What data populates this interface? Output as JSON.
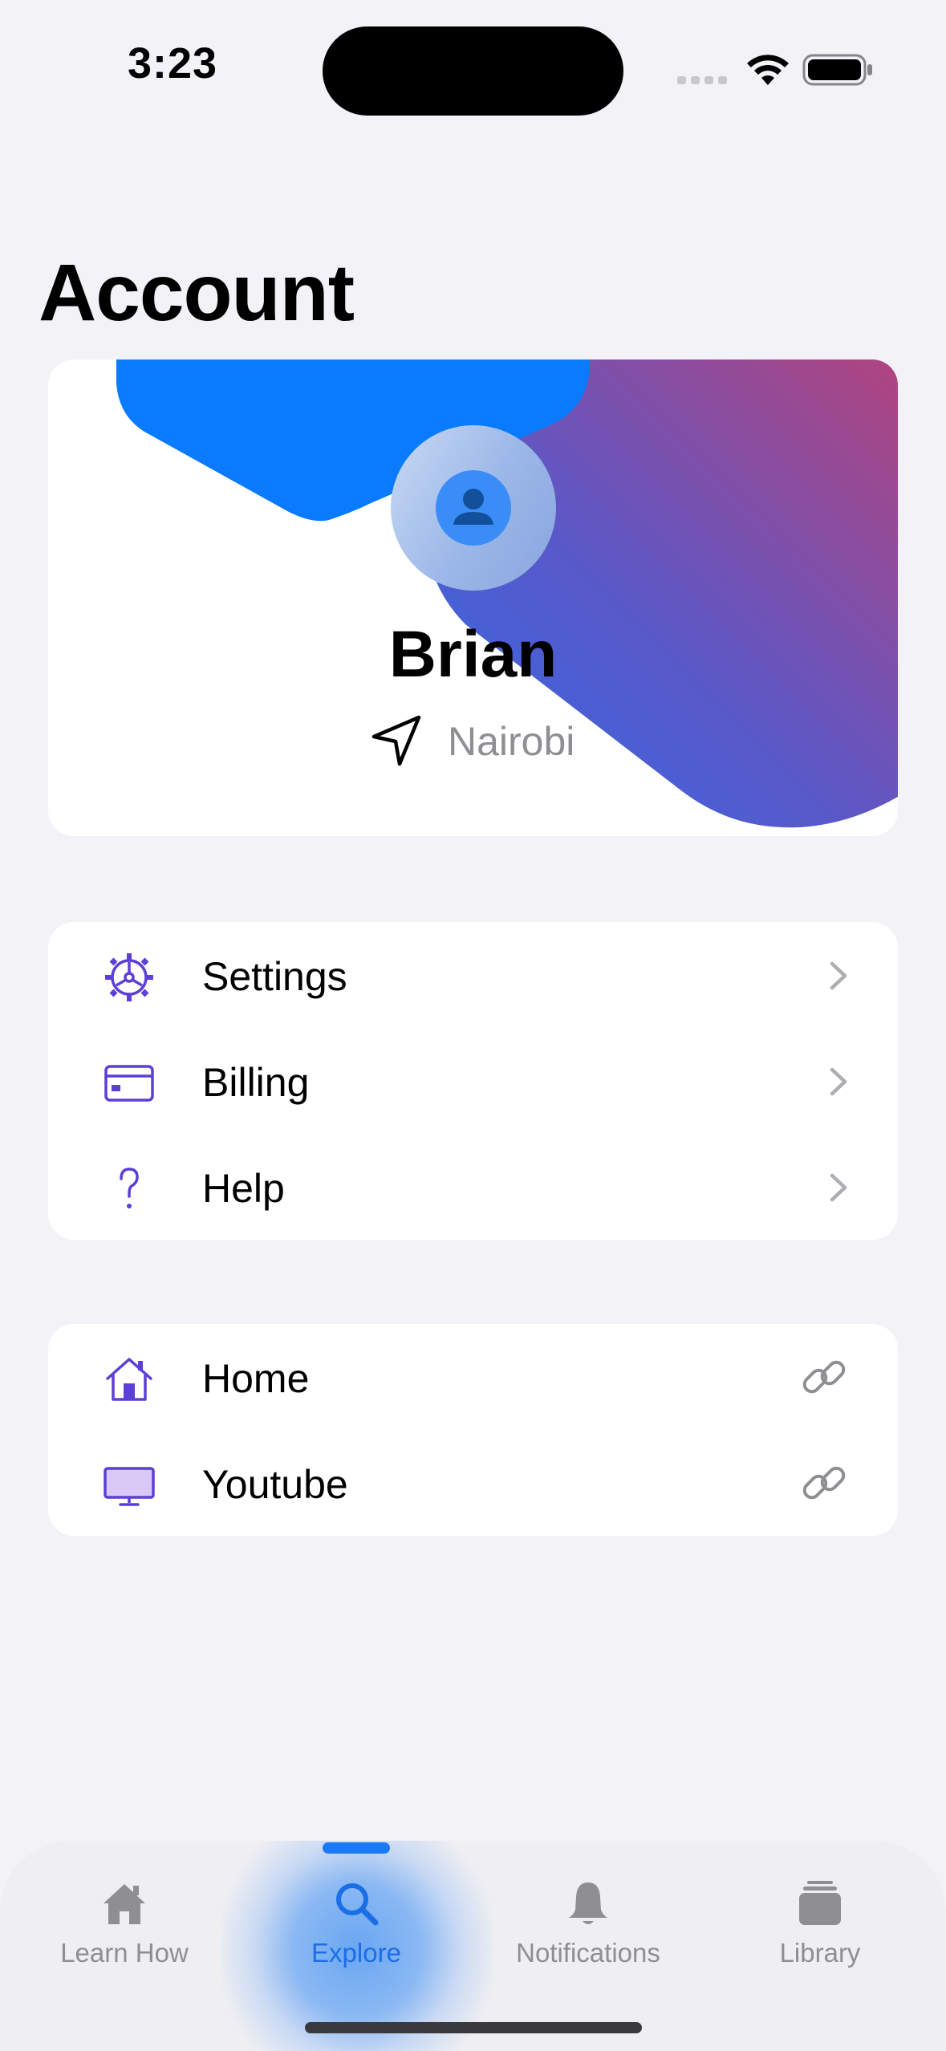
{
  "status_bar": {
    "time": "3:23",
    "signal_icon": "signal-dots-icon",
    "wifi_icon": "wifi-icon",
    "battery_icon": "battery-icon"
  },
  "page": {
    "title": "Account"
  },
  "profile": {
    "name": "Brian",
    "location": "Nairobi",
    "location_icon": "location-arrow-icon",
    "avatar_icon": "person-icon",
    "colors": {
      "blue": "#0a7bff",
      "gradient_start": "#3a6ee0",
      "gradient_end": "#b0447f"
    }
  },
  "menu": {
    "items": [
      {
        "label": "Settings",
        "icon": "gear-icon",
        "trailing": "chevron-right-icon"
      },
      {
        "label": "Billing",
        "icon": "credit-card-icon",
        "trailing": "chevron-right-icon"
      },
      {
        "label": "Help",
        "icon": "question-mark-icon",
        "trailing": "chevron-right-icon"
      }
    ]
  },
  "links": {
    "items": [
      {
        "label": "Home",
        "icon": "house-icon",
        "trailing": "link-icon"
      },
      {
        "label": "Youtube",
        "icon": "display-icon",
        "trailing": "link-icon"
      }
    ]
  },
  "tab_bar": {
    "active": "Explore",
    "accent": "#1a7af5",
    "tabs": [
      {
        "label": "Learn How",
        "icon": "house-fill-icon"
      },
      {
        "label": "Explore",
        "icon": "magnifying-glass-icon"
      },
      {
        "label": "Notifications",
        "icon": "bell-icon"
      },
      {
        "label": "Library",
        "icon": "stack-icon"
      }
    ]
  },
  "theme": {
    "icon_purple": "#5b3fd6",
    "chevron_gray": "#aeaeb2",
    "secondary_text": "#8e8e93",
    "background": "#f2f2f7"
  }
}
